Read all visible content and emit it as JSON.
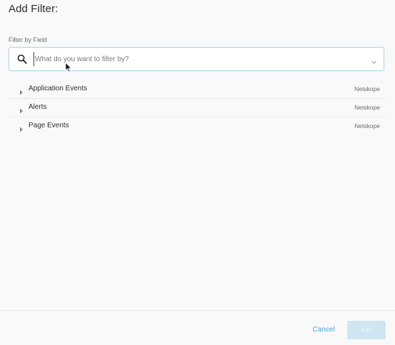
{
  "dialog": {
    "title": "Add Filter:"
  },
  "filter": {
    "label": "Filter by Field",
    "placeholder": "What do you want to filter by?",
    "value": "",
    "icons": {
      "search": "search-icon",
      "dropdown": "chevron-down-icon"
    }
  },
  "items": [
    {
      "label": "Application Events",
      "source": "Netskope"
    },
    {
      "label": "Alerts",
      "source": "Netskope"
    },
    {
      "label": "Page Events",
      "source": "Netskope"
    }
  ],
  "footer": {
    "cancel_label": "Cancel",
    "add_label": "Add"
  },
  "colors": {
    "accent": "#4aa3c7",
    "disabled_button": "#cfe6f0",
    "input_border": "#a9d0dd"
  }
}
